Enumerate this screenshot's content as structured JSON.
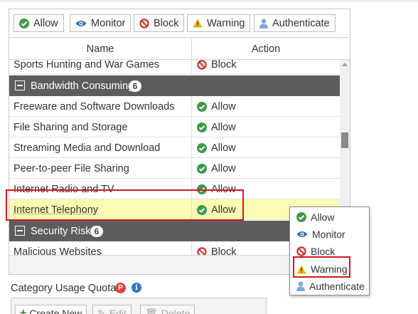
{
  "action_bar": {
    "buttons": [
      {
        "label": "Allow",
        "icon": "check-circle-icon"
      },
      {
        "label": "Monitor",
        "icon": "eye-icon"
      },
      {
        "label": "Block",
        "icon": "block-icon"
      },
      {
        "label": "Warning",
        "icon": "warning-icon"
      },
      {
        "label": "Authenticate",
        "icon": "user-icon"
      }
    ]
  },
  "table": {
    "columns": [
      "Name",
      "Action"
    ],
    "rows": [
      {
        "type": "row",
        "name": "Sports Hunting and War Games",
        "action": "Block"
      },
      {
        "type": "group",
        "name": "Bandwidth Consuming",
        "count": "6"
      },
      {
        "type": "row",
        "name": "Freeware and Software Downloads",
        "action": "Allow"
      },
      {
        "type": "row",
        "name": "File Sharing and Storage",
        "action": "Allow"
      },
      {
        "type": "row",
        "name": "Streaming Media and Download",
        "action": "Allow"
      },
      {
        "type": "row",
        "name": "Peer-to-peer File Sharing",
        "action": "Allow"
      },
      {
        "type": "row",
        "name": "Internet Radio and TV",
        "action": "Allow"
      },
      {
        "type": "row",
        "name": "Internet Telephony",
        "action": "Allow",
        "highlighted": true
      },
      {
        "type": "group",
        "name": "Security Risk",
        "count": "6"
      },
      {
        "type": "row",
        "name": "Malicious Websites",
        "action": "Block"
      }
    ]
  },
  "dropdown": {
    "items": [
      {
        "label": "Allow",
        "icon": "check-circle-icon"
      },
      {
        "label": "Monitor",
        "icon": "eye-icon"
      },
      {
        "label": "Block",
        "icon": "block-icon"
      },
      {
        "label": "Warning",
        "icon": "warning-icon",
        "selected": true
      },
      {
        "label": "Authenticate",
        "icon": "user-icon"
      }
    ]
  },
  "quota": {
    "label": "Category Usage Quota",
    "badge": "P",
    "info": "i"
  },
  "bottom_toolbar": {
    "create_label": "Create New",
    "edit_label": "Edit",
    "delete_label": "Delete"
  },
  "colors": {
    "allow": "#3c9a4a",
    "block": "#d22f2f",
    "monitor": "#2a6fb0",
    "warning": "#f0b400",
    "authenticate": "#7fa9dd",
    "highlight": "#fbfbb4",
    "group_header": "#5d5d5d",
    "callout": "#d0191e"
  }
}
